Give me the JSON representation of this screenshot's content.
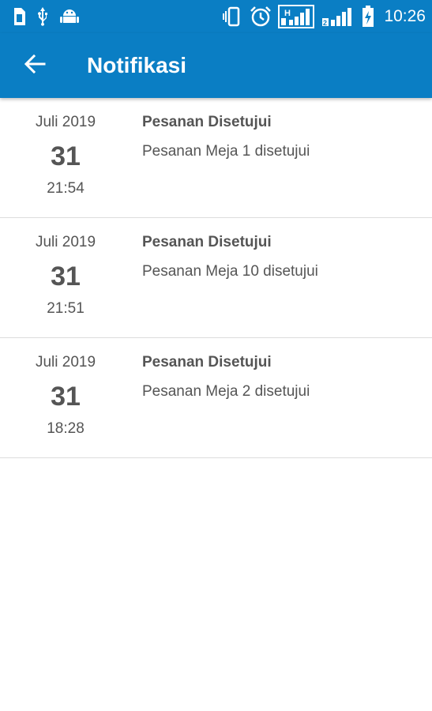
{
  "status_bar": {
    "time": "10:26",
    "icons": [
      "usb-icon",
      "android-icon",
      "vibrate-icon",
      "alarm-icon",
      "signal-sim1-icon",
      "signal-sim2-icon",
      "battery-charging-icon"
    ],
    "sim1_label": "H",
    "sim2_label": "2"
  },
  "app_bar": {
    "title": "Notifikasi",
    "back_icon": "arrow-left-icon"
  },
  "notifications": [
    {
      "month_year": "Juli 2019",
      "day": "31",
      "time": "21:54",
      "title": "Pesanan Disetujui",
      "body": "Pesanan Meja 1 disetujui"
    },
    {
      "month_year": "Juli 2019",
      "day": "31",
      "time": "21:51",
      "title": "Pesanan Disetujui",
      "body": "Pesanan Meja 10 disetujui"
    },
    {
      "month_year": "Juli 2019",
      "day": "31",
      "time": "18:28",
      "title": "Pesanan Disetujui",
      "body": "Pesanan Meja 2 disetujui"
    }
  ],
  "colors": {
    "primary": "#0a7ec4",
    "text": "#555555",
    "divider": "#dcdcdc"
  }
}
